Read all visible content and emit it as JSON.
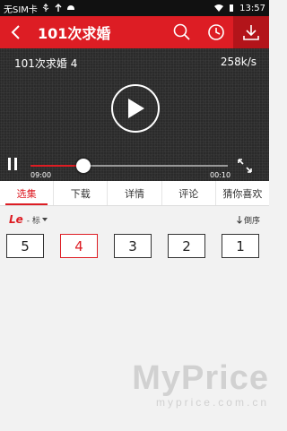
{
  "statusbar": {
    "carrier": "无SIM卡",
    "time": "13:57"
  },
  "titlebar": {
    "title": "101次求婚"
  },
  "player": {
    "video_title": "101次求婚 4",
    "speed": "258k/s",
    "current_time": "09:00",
    "total_time": "00:10",
    "progress": 0.27
  },
  "tabs": [
    {
      "label": "选集",
      "active": true
    },
    {
      "label": "下载",
      "active": false
    },
    {
      "label": "详情",
      "active": false
    },
    {
      "label": "评论",
      "active": false
    },
    {
      "label": "猜你喜欢",
      "active": false
    }
  ],
  "episodes_header": {
    "logo": "Le",
    "quality": "- 标",
    "sort_label": "倒序"
  },
  "episodes": [
    {
      "label": "5",
      "active": false
    },
    {
      "label": "4",
      "active": true
    },
    {
      "label": "3",
      "active": false
    },
    {
      "label": "2",
      "active": false
    },
    {
      "label": "1",
      "active": false
    }
  ],
  "watermark": {
    "big": "MyPrice",
    "small": "myprice.com.cn"
  },
  "colors": {
    "brand_red": "#dd1d24",
    "brand_red_dark": "#b3141a",
    "player_bg": "#2a2a2a"
  },
  "icons": [
    "back-icon",
    "search-icon",
    "history-icon",
    "download-icon",
    "play-icon",
    "pause-icon",
    "fullscreen-icon",
    "dropdown-icon",
    "sort-icon"
  ]
}
